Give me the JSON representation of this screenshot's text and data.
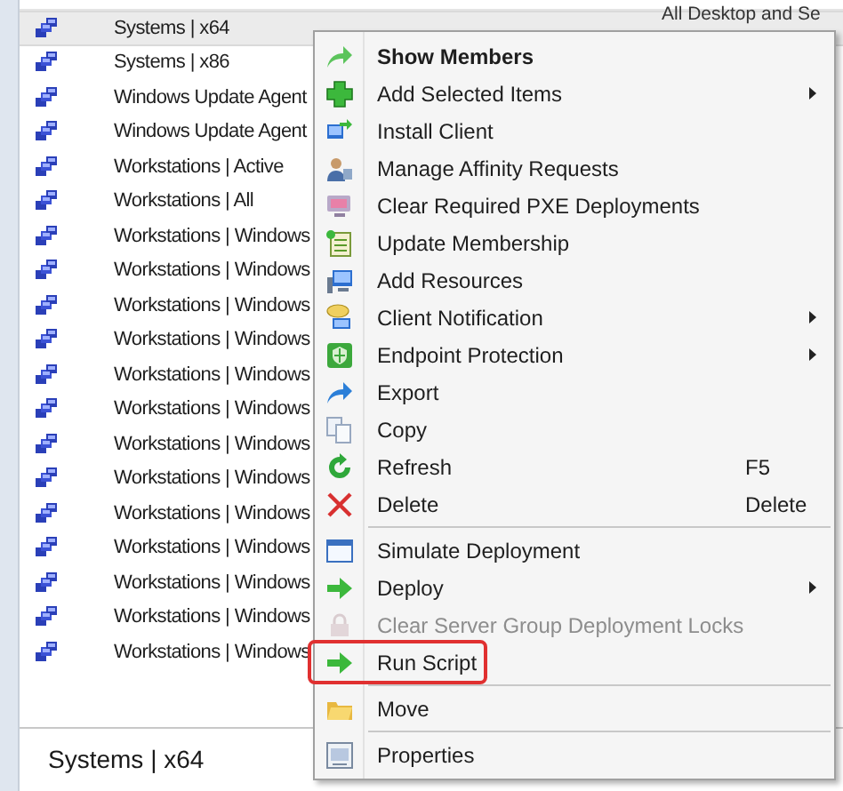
{
  "list": {
    "rows": [
      {
        "name": "Systems | x64",
        "column_2": "All Desktop and Se",
        "selected": true
      },
      {
        "name": "Systems | x86",
        "selected": false
      },
      {
        "name": "Windows Update Agent",
        "selected": false
      },
      {
        "name": "Windows Update Agent",
        "selected": false
      },
      {
        "name": "Workstations | Active",
        "selected": false
      },
      {
        "name": "Workstations | All",
        "selected": false
      },
      {
        "name": "Workstations | Windows",
        "selected": false
      },
      {
        "name": "Workstations | Windows",
        "selected": false
      },
      {
        "name": "Workstations | Windows",
        "selected": false
      },
      {
        "name": "Workstations | Windows",
        "selected": false
      },
      {
        "name": "Workstations | Windows",
        "selected": false
      },
      {
        "name": "Workstations | Windows",
        "selected": false
      },
      {
        "name": "Workstations | Windows",
        "selected": false
      },
      {
        "name": "Workstations | Windows",
        "selected": false
      },
      {
        "name": "Workstations | Windows",
        "selected": false
      },
      {
        "name": "Workstations | Windows",
        "selected": false
      },
      {
        "name": "Workstations | Windows",
        "selected": false
      },
      {
        "name": "Workstations | Windows",
        "selected": false
      },
      {
        "name": "Workstations | Windows",
        "selected": false
      }
    ]
  },
  "details": {
    "title": "Systems | x64"
  },
  "context_menu": {
    "items": [
      {
        "kind": "item",
        "label": "Show Members",
        "default": true,
        "submenu": false,
        "disabled": false,
        "callout": false
      },
      {
        "kind": "item",
        "label": "Add Selected Items",
        "default": false,
        "submenu": true,
        "disabled": false,
        "callout": false
      },
      {
        "kind": "item",
        "label": "Install Client",
        "default": false,
        "submenu": false,
        "disabled": false,
        "callout": false
      },
      {
        "kind": "item",
        "label": "Manage Affinity Requests",
        "default": false,
        "submenu": false,
        "disabled": false,
        "callout": false
      },
      {
        "kind": "item",
        "label": "Clear Required PXE Deployments",
        "default": false,
        "submenu": false,
        "disabled": false,
        "callout": false
      },
      {
        "kind": "item",
        "label": "Update Membership",
        "default": false,
        "submenu": false,
        "disabled": false,
        "callout": false
      },
      {
        "kind": "item",
        "label": "Add Resources",
        "default": false,
        "submenu": false,
        "disabled": false,
        "callout": false
      },
      {
        "kind": "item",
        "label": "Client Notification",
        "default": false,
        "submenu": true,
        "disabled": false,
        "callout": false
      },
      {
        "kind": "item",
        "label": "Endpoint Protection",
        "default": false,
        "submenu": true,
        "disabled": false,
        "callout": false
      },
      {
        "kind": "item",
        "label": "Export",
        "default": false,
        "submenu": false,
        "disabled": false,
        "callout": false
      },
      {
        "kind": "item",
        "label": "Copy",
        "default": false,
        "submenu": false,
        "disabled": false,
        "callout": false
      },
      {
        "kind": "item",
        "label": "Refresh",
        "shortcut": "F5",
        "default": false,
        "submenu": false,
        "disabled": false,
        "callout": false
      },
      {
        "kind": "item",
        "label": "Delete",
        "shortcut": "Delete",
        "default": false,
        "submenu": false,
        "disabled": false,
        "callout": false
      },
      {
        "kind": "separator"
      },
      {
        "kind": "item",
        "label": "Simulate Deployment",
        "default": false,
        "submenu": false,
        "disabled": false,
        "callout": false
      },
      {
        "kind": "item",
        "label": "Deploy",
        "default": false,
        "submenu": true,
        "disabled": false,
        "callout": false
      },
      {
        "kind": "item",
        "label": "Clear Server Group Deployment Locks",
        "default": false,
        "submenu": false,
        "disabled": true,
        "callout": false
      },
      {
        "kind": "item",
        "label": "Run Script",
        "default": false,
        "submenu": false,
        "disabled": false,
        "callout": true
      },
      {
        "kind": "separator"
      },
      {
        "kind": "item",
        "label": "Move",
        "default": false,
        "submenu": false,
        "disabled": false,
        "callout": false
      },
      {
        "kind": "separator"
      },
      {
        "kind": "item",
        "label": "Properties",
        "default": false,
        "submenu": false,
        "disabled": false,
        "callout": false
      }
    ]
  }
}
